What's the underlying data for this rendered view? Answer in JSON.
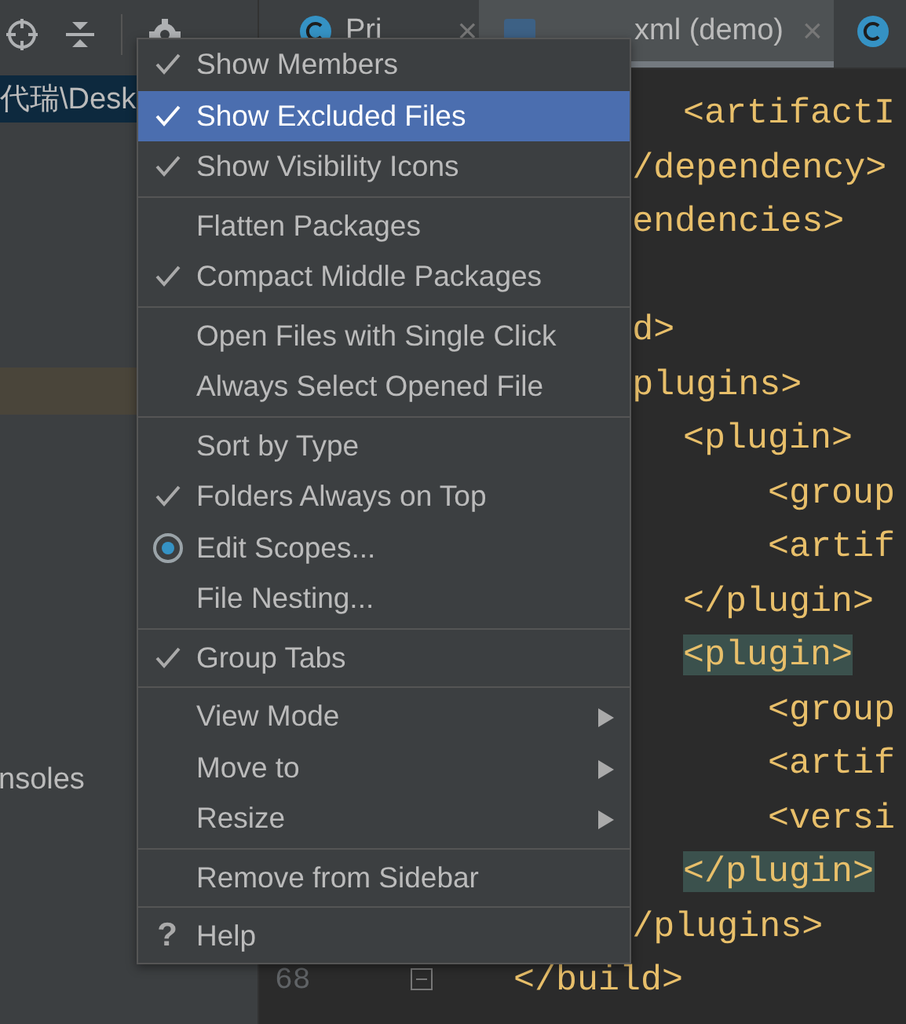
{
  "project_panel": {
    "rows": [
      {
        "kind": "selected",
        "label": "代瑞\\Desk"
      },
      {
        "kind": "highlighted"
      },
      {
        "kind": "plain",
        "label": "nsoles"
      }
    ]
  },
  "editor_tabs": [
    {
      "label": "Pri",
      "selected": false,
      "close": "×"
    },
    {
      "label": "xml (demo)",
      "selected": true,
      "close": "×"
    },
    {
      "selected": false
    }
  ],
  "code_lines": [
    {
      "text": "<artifactI",
      "highlighted": false
    },
    {
      "text": "/dependency>",
      "highlighted": false
    },
    {
      "text": "endencies>",
      "highlighted": false
    },
    {
      "text": "d>",
      "highlighted": false
    },
    {
      "text": "plugins>",
      "highlighted": false
    },
    {
      "text": "<plugin>",
      "highlighted": false
    },
    {
      "text": "<group",
      "highlighted": false
    },
    {
      "text": "<artif",
      "highlighted": false
    },
    {
      "text": "</plugin>",
      "highlighted": false
    },
    {
      "text": "<plugin>",
      "highlighted": true
    },
    {
      "text": "<group",
      "highlighted": false
    },
    {
      "text": "<artif",
      "highlighted": false
    },
    {
      "text": "<versi",
      "highlighted": false
    },
    {
      "text": "</plugin>",
      "highlighted": true
    },
    {
      "text": "/plugins>",
      "highlighted": false
    },
    {
      "number": "68",
      "text": "</build>",
      "highlighted": false
    }
  ],
  "menu": [
    {
      "items": [
        {
          "kind": "check",
          "label": "Show Members",
          "checked": true,
          "selected": false
        },
        {
          "kind": "check",
          "label": "Show Excluded Files",
          "checked": true,
          "selected": true
        },
        {
          "kind": "check",
          "label": "Show Visibility Icons",
          "checked": true,
          "selected": false
        }
      ]
    },
    {
      "items": [
        {
          "kind": "check",
          "label": "Flatten Packages",
          "checked": false,
          "selected": false
        },
        {
          "kind": "check",
          "label": "Compact Middle Packages",
          "checked": true,
          "selected": false
        }
      ]
    },
    {
      "items": [
        {
          "kind": "check",
          "label": "Open Files with Single Click",
          "checked": false,
          "selected": false
        },
        {
          "kind": "check",
          "label": "Always Select Opened File",
          "checked": false,
          "selected": false
        }
      ]
    },
    {
      "items": [
        {
          "kind": "check",
          "label": "Sort by Type",
          "checked": false,
          "selected": false
        },
        {
          "kind": "check",
          "label": "Folders Always on Top",
          "checked": true,
          "selected": false
        },
        {
          "kind": "scope",
          "label": "Edit Scopes...",
          "selected": false
        },
        {
          "kind": "plain",
          "label": "File Nesting...",
          "selected": false
        }
      ]
    },
    {
      "items": [
        {
          "kind": "check",
          "label": "Group Tabs",
          "checked": true,
          "selected": false
        }
      ]
    },
    {
      "items": [
        {
          "kind": "submenu",
          "label": "View Mode",
          "selected": false
        },
        {
          "kind": "submenu",
          "label": "Move to",
          "selected": false
        },
        {
          "kind": "submenu",
          "label": "Resize",
          "selected": false
        }
      ]
    },
    {
      "items": [
        {
          "kind": "plain",
          "label": "Remove from Sidebar",
          "selected": false
        }
      ]
    },
    {
      "items": [
        {
          "kind": "help",
          "icon": "?",
          "label": "Help",
          "selected": false
        }
      ]
    }
  ]
}
